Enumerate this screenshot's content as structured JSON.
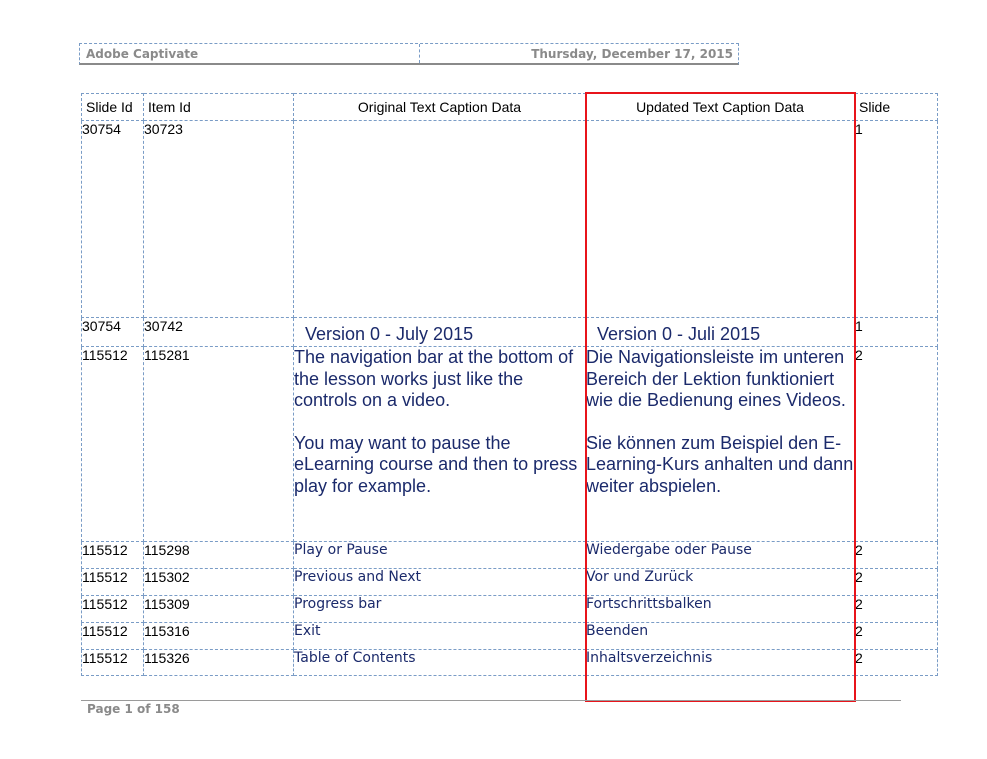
{
  "header": {
    "app_name": "Adobe Captivate",
    "date": "Thursday, December 17, 2015"
  },
  "table": {
    "columns": {
      "slide_id": "Slide Id",
      "item_id": "Item Id",
      "original": "Original Text Caption Data",
      "updated": "Updated Text Caption Data",
      "slide": "Slide"
    },
    "rows": [
      {
        "slide_id": "30754",
        "item_id": "30723",
        "original": [],
        "updated": [],
        "slide": "1"
      },
      {
        "slide_id": "30754",
        "item_id": "30742",
        "original": [
          "Version 0 - July 2015"
        ],
        "updated": [
          "Version 0 - Juli 2015"
        ],
        "slide": "1"
      },
      {
        "slide_id": "115512",
        "item_id": "115281",
        "original": [
          "The navigation bar at the bottom of the lesson works just like the controls on a video.",
          "You may want to pause the eLearning course and then to press play for example."
        ],
        "updated": [
          "Die Navigationsleiste im unteren Bereich der Lektion funktioniert wie die Bedienung eines Videos.",
          "Sie können zum Beispiel den E-Learning-Kurs anhalten und dann weiter abspielen."
        ],
        "slide": "2"
      },
      {
        "slide_id": "115512",
        "item_id": "115298",
        "original": [
          "Play or Pause"
        ],
        "updated": [
          "Wiedergabe oder Pause"
        ],
        "slide": "2"
      },
      {
        "slide_id": "115512",
        "item_id": "115302",
        "original": [
          "Previous and Next"
        ],
        "updated": [
          "Vor und Zurück"
        ],
        "slide": "2"
      },
      {
        "slide_id": "115512",
        "item_id": "115309",
        "original": [
          "Progress bar"
        ],
        "updated": [
          "Fortschrittsbalken"
        ],
        "slide": "2"
      },
      {
        "slide_id": "115512",
        "item_id": "115316",
        "original": [
          "Exit"
        ],
        "updated": [
          "Beenden"
        ],
        "slide": "2"
      },
      {
        "slide_id": "115512",
        "item_id": "115326",
        "original": [
          "Table of Contents"
        ],
        "updated": [
          "Inhaltsverzeichnis"
        ],
        "slide": "2"
      }
    ]
  },
  "footer": {
    "page_label": "Page 1 of 158"
  },
  "colors": {
    "caption_text": "#1b2a6b",
    "highlight_border": "#e8141b",
    "grid_line": "#7a9cc6"
  }
}
